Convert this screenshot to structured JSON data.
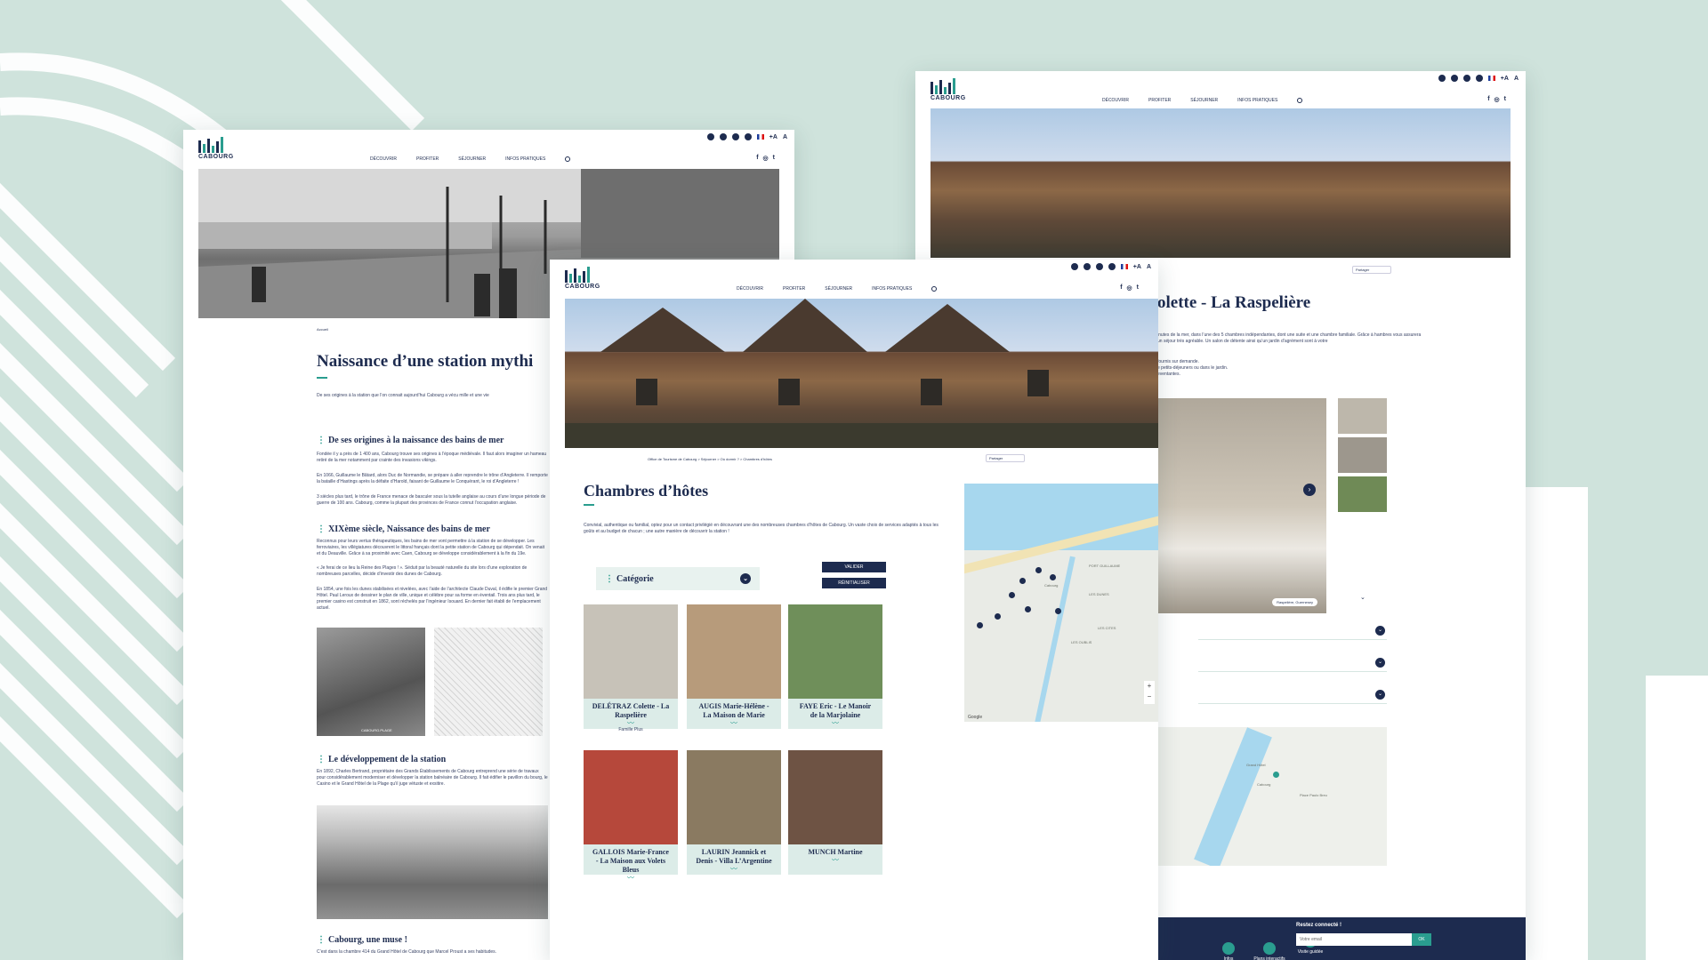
{
  "colors": {
    "background": "#cfe3dc",
    "navy": "#1d2b4f",
    "teal": "#2a9d8f",
    "card": "#dcece8"
  },
  "brand": {
    "name": "CABOURG"
  },
  "nav": {
    "items": [
      "DÉCOUVRIR",
      "PROFITER",
      "SÉJOURNER",
      "INFOS PRATIQUES"
    ]
  },
  "font_size_toggle": {
    "larger": "+A",
    "smaller": "A"
  },
  "left_page": {
    "breadcrumb": "Accueil",
    "title": "Naissance d’une station mythi",
    "intro": "De ses origines à la station que l’on connait aujourd’hui Cabourg a vécu mille et une vie",
    "sections": [
      {
        "heading": "De ses origines à la naissance des bains de mer",
        "paragraphs": [
          "Fondée il y a près de 1 400 ans, Cabourg trouve ses origines à l’époque médiévale. Il faut alors imaginer un hameau retiré de la mer notamment par crainte des invasions vikings.",
          "En 1066, Guillaume le Bâtard, alors Duc de Normandie, se prépare à aller reprendre le trône d’Angleterre. Il remporte la bataille d’Hastings après la défaite d’Harold, faisant de Guillaume le Conquérant, le roi d’Angleterre !",
          "3 siècles plus tard, le trône de France menace de basculer sous la tutelle anglaise au cours d’une longue période de guerre de 100 ans. Cabourg, comme la plupart des provinces de France connut l’occupation anglaise."
        ]
      },
      {
        "heading": "XIXème siècle, Naissance des bains de mer",
        "paragraphs": [
          "Reconnus pour leurs vertus thérapeutiques, les bains de mer vont permettre à la station de se développer. Les ferroviaires, les villégiatures découvrent le littoral français dont la petite station de Cabourg qui dépendait. On venait et du Deauville. Grâce à sa proximité avec Caen, Cabourg se développe considérablement à la fin du 19e.",
          "« Je ferai de ce lieu la Reine des Plages ! ». Séduit par la beauté naturelle du site lors d’une exploration de nombreuses parcelles, décide d’investir des dunes de Cabourg.",
          "En 1854, une fois les dunes stabilisées et nivelées, avec l’aide de l’architecte Claude Duval, il édifie le premier Grand Hôtel. Paul Leroux de dessiner le plan de ville, unique et célèbre pour sa forme en éventail. Trois ans plus tard, le premier casino est construit en 1862, sont réchelés par l’ingénieur Isouard. En dernier fait établi de l’emplacement actuel."
        ]
      },
      {
        "heading": "Le développement de la station",
        "paragraphs": [
          "En 1892, Charles Bertrand, propriétaire des Grands Établissements de Cabourg entreprend une série de travaux pour considérablement moderniser et développer la station balnéaire de Cabourg. Il fait édifier le pavillon du bourg, le Casino et le Grand Hôtel de la Plage qu’il juge vétuste et exsitire."
        ]
      },
      {
        "heading": "Cabourg, une muse !",
        "paragraphs": [
          "C’est dans la chambre 414 du Grand Hôtel de Cabourg que Marcel Proust a ses habitudes."
        ]
      }
    ],
    "photo_caption": "CABOURG.PLAGE"
  },
  "center_page": {
    "breadcrumb": "Office de Tourisme de Cabourg > Séjourner > Où dormir ? > Chambres d’hôtes",
    "share_label": "Partager",
    "title": "Chambres d’hôtes",
    "intro": "Convivial, authentique ou familial, optez pour un contact privilégié en découvrant une des nombreuses chambres d’hôtes de Cabourg. Un vaste choix de services adaptés à tous les goûts et au budget de chacun ; une autre manière de découvrir la station !",
    "filter": {
      "label": "Catégorie",
      "validate": "VALIDER",
      "reset": "RÉINITIALISER"
    },
    "listings": [
      {
        "name": "DELÉTRAZ Colette - La Raspelière",
        "tag": "Famille Plus",
        "photo": "#c7c2b8"
      },
      {
        "name": "AUGIS Marie-Hélène - La Maison de Marie",
        "tag": "",
        "photo": "#b79b7b"
      },
      {
        "name": "FAYE Eric - Le Manoir de la Marjolaine",
        "tag": "",
        "photo": "#6f8f5a"
      },
      {
        "name": "GALLOIS Marie-France - La Maison aux Volets Bleus",
        "tag": "",
        "photo": "#b6483b"
      },
      {
        "name": "LAURIN Jeannick et Denis - Villa L’Argentine",
        "tag": "",
        "photo": "#8a7a61"
      },
      {
        "name": "MUNCH Martine",
        "tag": "",
        "photo": "#6e5344"
      }
    ],
    "map": {
      "attribution": "Google",
      "labels": [
        "Cabourg",
        "LES DUNES",
        "LES OUBLIS",
        "LES CITES",
        "PORT GUILLAUME"
      ],
      "zoom_in": "+",
      "zoom_out": "−"
    }
  },
  "right_page": {
    "share_label": "Partager",
    "title": "olette - La Raspelière",
    "intro": "inutes de la mer, dans l’une des 5 chambres indépendantes, dont une suite et une chambre familiale. Grâce à hambres vous assurera un séjour très agréable. Un salon de détente ainsi qu’un jardin d’agrément sont à votre",
    "details": [
      "fournis sur demande.",
      "e petits-déjeuners ou dans le jardin.",
      "eventantes."
    ],
    "gallery_caption": "Raspelière, Guernesey",
    "map_labels": [
      "Cabourg",
      "Grand Hôtel",
      "Place Paulo Breu"
    ],
    "footer": {
      "newsletter_title": "Restez connecté !",
      "email_placeholder": "Votre email",
      "ok": "OK",
      "links": [
        "Infos",
        "Plans interactifs",
        "Visite guidée"
      ]
    }
  }
}
